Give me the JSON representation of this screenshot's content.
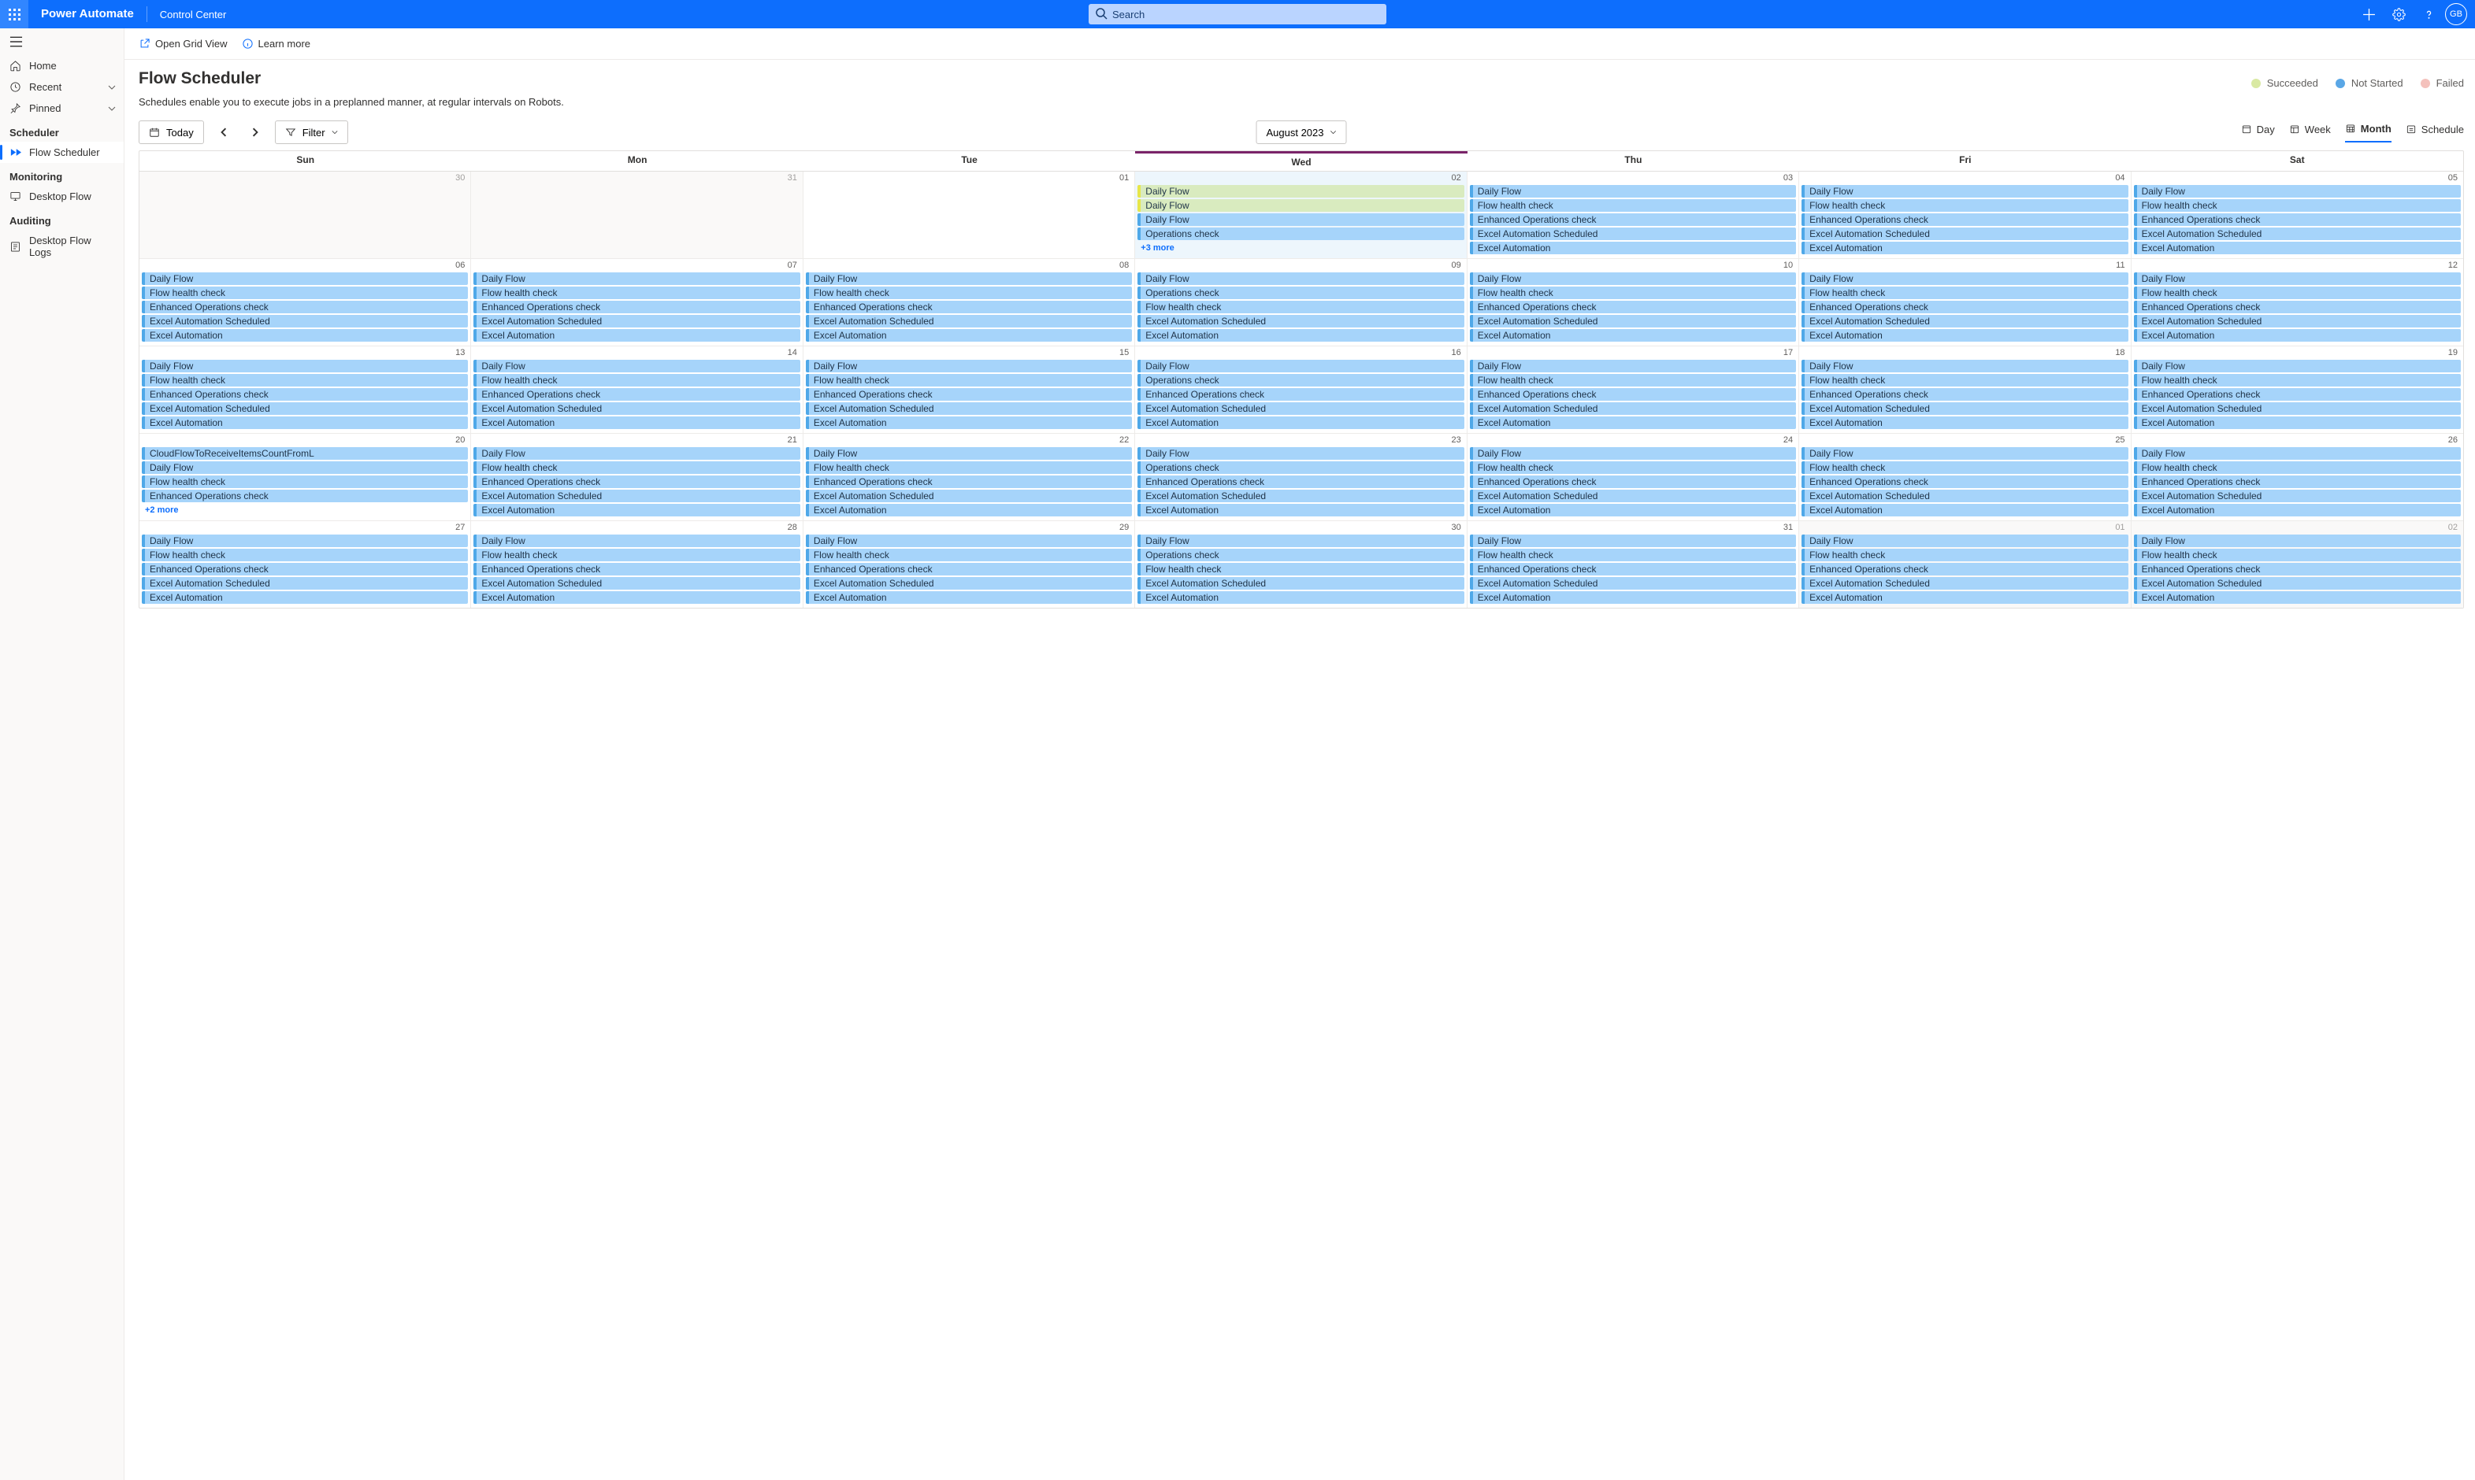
{
  "header": {
    "brand": "Power Automate",
    "breadcrumb": "Control Center",
    "search_placeholder": "Search",
    "avatar_initials": "GB"
  },
  "nav": {
    "items_top": [
      {
        "label": "Home"
      },
      {
        "label": "Recent",
        "has_chevron": true
      },
      {
        "label": "Pinned",
        "has_chevron": true
      }
    ],
    "section_scheduler": "Scheduler",
    "item_flow_scheduler": "Flow Scheduler",
    "section_monitoring": "Monitoring",
    "item_desktop_flow": "Desktop Flow",
    "section_auditing": "Auditing",
    "item_desktop_flow_logs": "Desktop Flow Logs"
  },
  "cmdbar": {
    "open_grid_view": "Open Grid View",
    "learn_more": "Learn more"
  },
  "page": {
    "title": "Flow Scheduler",
    "subtitle": "Schedules enable you to execute jobs in a preplanned manner, at regular intervals on Robots."
  },
  "legend": {
    "succeeded_label": "Succeeded",
    "succeeded_color": "#d9e9a3",
    "not_started_label": "Not Started",
    "not_started_color": "#5aa7e6",
    "failed_label": "Failed",
    "failed_color": "#f4c1bc"
  },
  "toolstrip": {
    "today": "Today",
    "filter": "Filter",
    "current_month": "August 2023",
    "view_day": "Day",
    "view_week": "Week",
    "view_month": "Month",
    "view_schedule": "Schedule"
  },
  "calendar": {
    "weekdays": [
      "Sun",
      "Mon",
      "Tue",
      "Wed",
      "Thu",
      "Fri",
      "Sat"
    ],
    "today_weekday_index": 3,
    "weeks": [
      {
        "days": [
          {
            "num": "30",
            "other": true,
            "events": []
          },
          {
            "num": "31",
            "other": true,
            "events": []
          },
          {
            "num": "01",
            "events": []
          },
          {
            "num": "02",
            "is_today": true,
            "events": [
              {
                "label": "Daily Flow",
                "status": "succ"
              },
              {
                "label": "Daily Flow",
                "status": "succ"
              },
              {
                "label": "Daily Flow"
              },
              {
                "label": "Operations check"
              }
            ],
            "more": "+3 more"
          },
          {
            "num": "03",
            "events": [
              {
                "label": "Daily Flow"
              },
              {
                "label": "Flow health check"
              },
              {
                "label": "Enhanced Operations check"
              },
              {
                "label": "Excel Automation Scheduled"
              },
              {
                "label": "Excel Automation"
              }
            ]
          },
          {
            "num": "04",
            "events": [
              {
                "label": "Daily Flow"
              },
              {
                "label": "Flow health check"
              },
              {
                "label": "Enhanced Operations check"
              },
              {
                "label": "Excel Automation Scheduled"
              },
              {
                "label": "Excel Automation"
              }
            ]
          },
          {
            "num": "05",
            "events": [
              {
                "label": "Daily Flow"
              },
              {
                "label": "Flow health check"
              },
              {
                "label": "Enhanced Operations check"
              },
              {
                "label": "Excel Automation Scheduled"
              },
              {
                "label": "Excel Automation"
              }
            ]
          }
        ]
      },
      {
        "days": [
          {
            "num": "06",
            "events": [
              {
                "label": "Daily Flow"
              },
              {
                "label": "Flow health check"
              },
              {
                "label": "Enhanced Operations check"
              },
              {
                "label": "Excel Automation Scheduled"
              },
              {
                "label": "Excel Automation"
              }
            ]
          },
          {
            "num": "07",
            "events": [
              {
                "label": "Daily Flow"
              },
              {
                "label": "Flow health check"
              },
              {
                "label": "Enhanced Operations check"
              },
              {
                "label": "Excel Automation Scheduled"
              },
              {
                "label": "Excel Automation"
              }
            ]
          },
          {
            "num": "08",
            "events": [
              {
                "label": "Daily Flow"
              },
              {
                "label": "Flow health check"
              },
              {
                "label": "Enhanced Operations check"
              },
              {
                "label": "Excel Automation Scheduled"
              },
              {
                "label": "Excel Automation"
              }
            ]
          },
          {
            "num": "09",
            "events": [
              {
                "label": "Daily Flow"
              },
              {
                "label": "Operations check"
              },
              {
                "label": "Flow health check"
              },
              {
                "label": "Excel Automation Scheduled"
              },
              {
                "label": "Excel Automation"
              }
            ]
          },
          {
            "num": "10",
            "events": [
              {
                "label": "Daily Flow"
              },
              {
                "label": "Flow health check"
              },
              {
                "label": "Enhanced Operations check"
              },
              {
                "label": "Excel Automation Scheduled"
              },
              {
                "label": "Excel Automation"
              }
            ]
          },
          {
            "num": "11",
            "events": [
              {
                "label": "Daily Flow"
              },
              {
                "label": "Flow health check"
              },
              {
                "label": "Enhanced Operations check"
              },
              {
                "label": "Excel Automation Scheduled"
              },
              {
                "label": "Excel Automation"
              }
            ]
          },
          {
            "num": "12",
            "events": [
              {
                "label": "Daily Flow"
              },
              {
                "label": "Flow health check"
              },
              {
                "label": "Enhanced Operations check"
              },
              {
                "label": "Excel Automation Scheduled"
              },
              {
                "label": "Excel Automation"
              }
            ]
          }
        ]
      },
      {
        "days": [
          {
            "num": "13",
            "events": [
              {
                "label": "Daily Flow"
              },
              {
                "label": "Flow health check"
              },
              {
                "label": "Enhanced Operations check"
              },
              {
                "label": "Excel Automation Scheduled"
              },
              {
                "label": "Excel Automation"
              }
            ]
          },
          {
            "num": "14",
            "events": [
              {
                "label": "Daily Flow"
              },
              {
                "label": "Flow health check"
              },
              {
                "label": "Enhanced Operations check"
              },
              {
                "label": "Excel Automation Scheduled"
              },
              {
                "label": "Excel Automation"
              }
            ]
          },
          {
            "num": "15",
            "events": [
              {
                "label": "Daily Flow"
              },
              {
                "label": "Flow health check"
              },
              {
                "label": "Enhanced Operations check"
              },
              {
                "label": "Excel Automation Scheduled"
              },
              {
                "label": "Excel Automation"
              }
            ]
          },
          {
            "num": "16",
            "events": [
              {
                "label": "Daily Flow"
              },
              {
                "label": "Operations check"
              },
              {
                "label": "Enhanced Operations check"
              },
              {
                "label": "Excel Automation Scheduled"
              },
              {
                "label": "Excel Automation"
              }
            ]
          },
          {
            "num": "17",
            "events": [
              {
                "label": "Daily Flow"
              },
              {
                "label": "Flow health check"
              },
              {
                "label": "Enhanced Operations check"
              },
              {
                "label": "Excel Automation Scheduled"
              },
              {
                "label": "Excel Automation"
              }
            ]
          },
          {
            "num": "18",
            "events": [
              {
                "label": "Daily Flow"
              },
              {
                "label": "Flow health check"
              },
              {
                "label": "Enhanced Operations check"
              },
              {
                "label": "Excel Automation Scheduled"
              },
              {
                "label": "Excel Automation"
              }
            ]
          },
          {
            "num": "19",
            "events": [
              {
                "label": "Daily Flow"
              },
              {
                "label": "Flow health check"
              },
              {
                "label": "Enhanced Operations check"
              },
              {
                "label": "Excel Automation Scheduled"
              },
              {
                "label": "Excel Automation"
              }
            ]
          }
        ]
      },
      {
        "days": [
          {
            "num": "20",
            "events": [
              {
                "label": "CloudFlowToReceiveItemsCountFromL"
              },
              {
                "label": "Daily Flow"
              },
              {
                "label": "Flow health check"
              },
              {
                "label": "Enhanced Operations check"
              }
            ],
            "more": "+2 more"
          },
          {
            "num": "21",
            "events": [
              {
                "label": "Daily Flow"
              },
              {
                "label": "Flow health check"
              },
              {
                "label": "Enhanced Operations check"
              },
              {
                "label": "Excel Automation Scheduled"
              },
              {
                "label": "Excel Automation"
              }
            ]
          },
          {
            "num": "22",
            "events": [
              {
                "label": "Daily Flow"
              },
              {
                "label": "Flow health check"
              },
              {
                "label": "Enhanced Operations check"
              },
              {
                "label": "Excel Automation Scheduled"
              },
              {
                "label": "Excel Automation"
              }
            ]
          },
          {
            "num": "23",
            "events": [
              {
                "label": "Daily Flow"
              },
              {
                "label": "Operations check"
              },
              {
                "label": "Enhanced Operations check"
              },
              {
                "label": "Excel Automation Scheduled"
              },
              {
                "label": "Excel Automation"
              }
            ]
          },
          {
            "num": "24",
            "events": [
              {
                "label": "Daily Flow"
              },
              {
                "label": "Flow health check"
              },
              {
                "label": "Enhanced Operations check"
              },
              {
                "label": "Excel Automation Scheduled"
              },
              {
                "label": "Excel Automation"
              }
            ]
          },
          {
            "num": "25",
            "events": [
              {
                "label": "Daily Flow"
              },
              {
                "label": "Flow health check"
              },
              {
                "label": "Enhanced Operations check"
              },
              {
                "label": "Excel Automation Scheduled"
              },
              {
                "label": "Excel Automation"
              }
            ]
          },
          {
            "num": "26",
            "events": [
              {
                "label": "Daily Flow"
              },
              {
                "label": "Flow health check"
              },
              {
                "label": "Enhanced Operations check"
              },
              {
                "label": "Excel Automation Scheduled"
              },
              {
                "label": "Excel Automation"
              }
            ]
          }
        ]
      },
      {
        "days": [
          {
            "num": "27",
            "events": [
              {
                "label": "Daily Flow"
              },
              {
                "label": "Flow health check"
              },
              {
                "label": "Enhanced Operations check"
              },
              {
                "label": "Excel Automation Scheduled"
              },
              {
                "label": "Excel Automation"
              }
            ]
          },
          {
            "num": "28",
            "events": [
              {
                "label": "Daily Flow"
              },
              {
                "label": "Flow health check"
              },
              {
                "label": "Enhanced Operations check"
              },
              {
                "label": "Excel Automation Scheduled"
              },
              {
                "label": "Excel Automation"
              }
            ]
          },
          {
            "num": "29",
            "events": [
              {
                "label": "Daily Flow"
              },
              {
                "label": "Flow health check"
              },
              {
                "label": "Enhanced Operations check"
              },
              {
                "label": "Excel Automation Scheduled"
              },
              {
                "label": "Excel Automation"
              }
            ]
          },
          {
            "num": "30",
            "events": [
              {
                "label": "Daily Flow"
              },
              {
                "label": "Operations check"
              },
              {
                "label": "Flow health check"
              },
              {
                "label": "Excel Automation Scheduled"
              },
              {
                "label": "Excel Automation"
              }
            ]
          },
          {
            "num": "31",
            "events": [
              {
                "label": "Daily Flow"
              },
              {
                "label": "Flow health check"
              },
              {
                "label": "Enhanced Operations check"
              },
              {
                "label": "Excel Automation Scheduled"
              },
              {
                "label": "Excel Automation"
              }
            ]
          },
          {
            "num": "01",
            "other": true,
            "events": [
              {
                "label": "Daily Flow"
              },
              {
                "label": "Flow health check"
              },
              {
                "label": "Enhanced Operations check"
              },
              {
                "label": "Excel Automation Scheduled"
              },
              {
                "label": "Excel Automation"
              }
            ]
          },
          {
            "num": "02",
            "other": true,
            "events": [
              {
                "label": "Daily Flow"
              },
              {
                "label": "Flow health check"
              },
              {
                "label": "Enhanced Operations check"
              },
              {
                "label": "Excel Automation Scheduled"
              },
              {
                "label": "Excel Automation"
              }
            ]
          }
        ]
      }
    ]
  }
}
